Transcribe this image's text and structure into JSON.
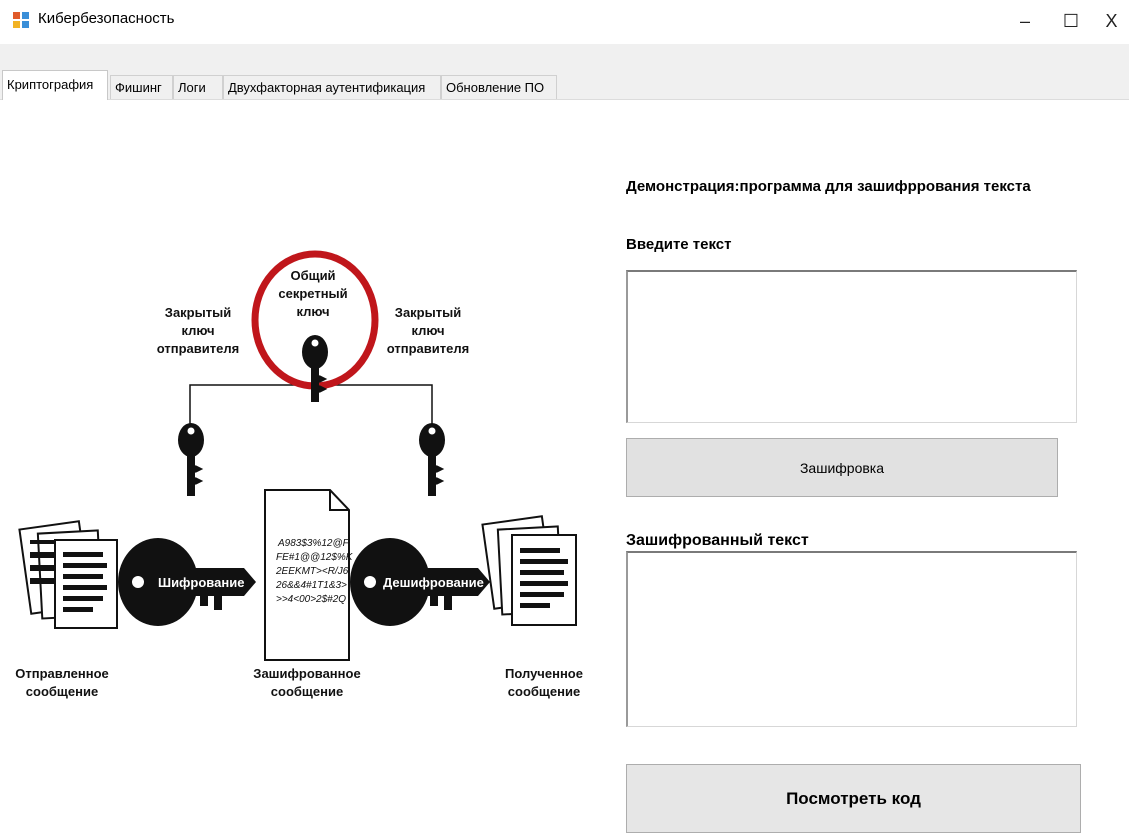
{
  "window": {
    "title": "Кибербезопасность",
    "controls": {
      "minimize": "–",
      "maximize": "☐",
      "close": "X"
    }
  },
  "tabs": [
    {
      "label": "Криптография",
      "active": true
    },
    {
      "label": "Фишинг",
      "active": false
    },
    {
      "label": "Логи",
      "active": false
    },
    {
      "label": "Двухфакторная аутентификация",
      "active": false
    },
    {
      "label": "Обновление ПО",
      "active": false
    }
  ],
  "diagram": {
    "shared_key": [
      "Общий",
      "секретный",
      "ключ"
    ],
    "left_private_key": [
      "Закрытый",
      "ключ",
      "отправителя"
    ],
    "right_private_key": [
      "Закрытый",
      "ключ",
      "отправителя"
    ],
    "encrypt_label": "Шифрование",
    "decrypt_label": "Дешифрование",
    "cipher_lines": [
      "A983$3%12@F",
      "FE#1@@12$%K",
      "2EEKMT><R/J6",
      "26&&4#1T1&3>",
      ">>4<00>2$#2Q"
    ],
    "sent_label": [
      "Отправленное",
      "сообщение"
    ],
    "encrypted_label": [
      "Зашифрованное",
      "сообщение"
    ],
    "received_label": [
      "Полученное",
      "сообщение"
    ],
    "accent_color": "#c0161b"
  },
  "panel": {
    "demo_heading": "Демонстрация:программа для зашифррования текста",
    "input_label": "Введите текст",
    "input_value": "",
    "encrypt_button": "Зашифровка",
    "output_label": "Зашифрованный текст",
    "output_value": "",
    "view_code_button": "Посмотреть код"
  }
}
